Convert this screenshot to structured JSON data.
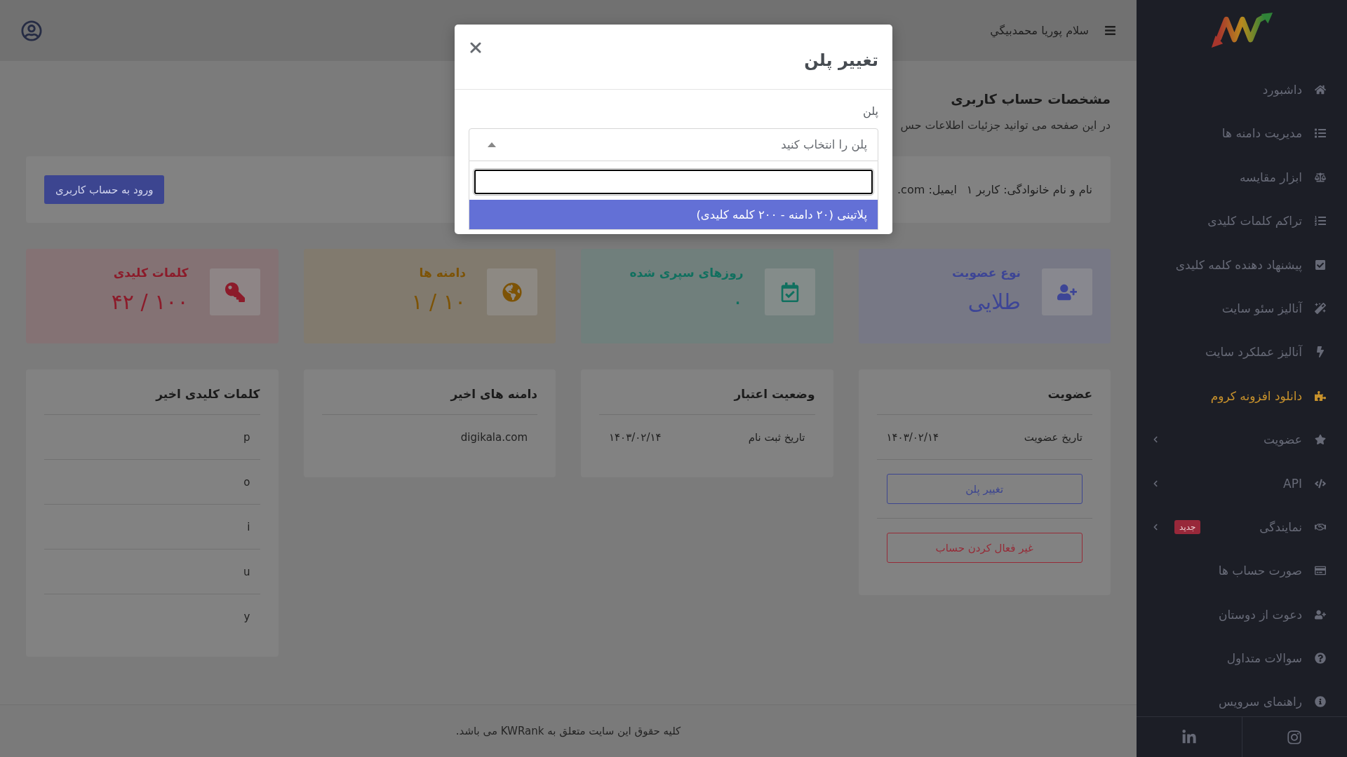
{
  "sidebar": {
    "items": [
      {
        "label": "داشبورد",
        "selected": false,
        "kind": "link"
      },
      {
        "label": "مدیریت دامنه ها",
        "selected": false,
        "kind": "link"
      },
      {
        "label": "ابزار مقایسه",
        "selected": false,
        "kind": "link"
      },
      {
        "label": "تراکم کلمات کلیدی",
        "selected": false,
        "kind": "link"
      },
      {
        "label": "پیشنهاد دهنده کلمه کلیدی",
        "selected": false,
        "kind": "link"
      },
      {
        "label": "آنالیز سئو سایت",
        "selected": false,
        "kind": "link"
      },
      {
        "label": "آنالیز عملکرد سایت",
        "selected": false,
        "kind": "link"
      },
      {
        "label": "دانلود افزونه کروم",
        "selected": true,
        "kind": "link"
      },
      {
        "label": "عضویت",
        "selected": false,
        "kind": "submenu"
      },
      {
        "label": "API",
        "selected": false,
        "kind": "submenu"
      },
      {
        "label": "نمایندگی",
        "selected": false,
        "kind": "submenu",
        "badge": "جدید"
      },
      {
        "label": "صورت حساب ها",
        "selected": false,
        "kind": "link"
      },
      {
        "label": "دعوت از دوستان",
        "selected": false,
        "kind": "link"
      },
      {
        "label": "سوالات متداول",
        "selected": false,
        "kind": "link"
      },
      {
        "label": "راهنمای سرویس",
        "selected": false,
        "kind": "link"
      }
    ]
  },
  "header": {
    "greeting": "سلام پوریا محمدبیگي"
  },
  "page": {
    "title": "مشخصات حساب کاربری",
    "subtitle": "در این صفحه می توانید جزئیات اطلاعات حس"
  },
  "profile": {
    "fields": [
      {
        "label": "نام و نام خانوادگی:",
        "value": "کاربر ۱"
      },
      {
        "label": "ایمیل:",
        "value": ".com"
      }
    ],
    "button": "ورود به حساب کاربری"
  },
  "stat_cards": [
    {
      "title": "نوع عضویت",
      "value": "طلایی",
      "color": "#3d4596"
    },
    {
      "title": "روزهای سپری شده",
      "value": "۰",
      "color": "#11705f"
    },
    {
      "title": "دامنه ها",
      "value": "۱ / ۱۰",
      "color": "#7d5306"
    },
    {
      "title": "کلمات کلیدی",
      "value": "۴۲ / ۱۰۰",
      "color": "#8c1b2a"
    }
  ],
  "panels": [
    {
      "title": "عضویت",
      "rows": [
        {
          "label": "تاریخ عضویت",
          "value": "۱۴۰۳/۰۲/۱۴"
        }
      ],
      "buttons": [
        {
          "label": "تغییر پلن",
          "kind": "primary"
        },
        {
          "label": "غیر فعال کردن حساب",
          "kind": "danger"
        }
      ]
    },
    {
      "title": "وضعیت اعتبار",
      "rows": [
        {
          "label": "تاریخ ثبت نام",
          "value": "۱۴۰۳/۰۲/۱۴"
        }
      ]
    },
    {
      "title": "دامنه های اخیر",
      "items": [
        "digikala.com"
      ]
    },
    {
      "title": "کلمات کلیدی اخیر",
      "items": [
        "p",
        "o",
        "i",
        "u",
        "y"
      ]
    }
  ],
  "footer": {
    "text": "کلیه حقوق این سایت متعلق به KWRank می باشد."
  },
  "modal": {
    "title": "تغییر پلن",
    "field_label": "پلن",
    "select": {
      "placeholder": "پلن را انتخاب کنید",
      "expanded": true
    },
    "search": {
      "focused": true
    },
    "options": [
      {
        "label": "پلاتینی (۲۰ دامنه - ۲۰۰ کلمه کلیدی)",
        "selected": true
      }
    ]
  }
}
